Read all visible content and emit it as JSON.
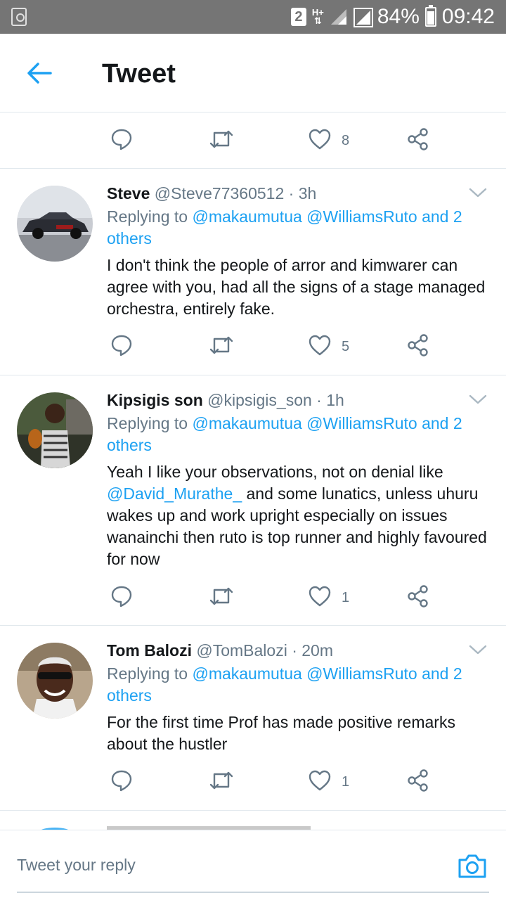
{
  "status_bar": {
    "sim": "2",
    "network": "H+",
    "battery": "84%",
    "time": "09:42"
  },
  "header": {
    "back_icon": "arrow-left-icon",
    "title": "Tweet"
  },
  "colors": {
    "accent": "#1da1f2",
    "secondary_text": "#657786",
    "primary_text": "#14171a",
    "divider": "#e1e8ed"
  },
  "top_actions": {
    "like_count": "8"
  },
  "tweets": [
    {
      "name": "Steve",
      "handle": "@Steve77360512",
      "time": "· 3h",
      "replying_prefix": "Replying to",
      "replying_to": "@makaumutua @WilliamsRuto and 2 others",
      "text": "I don't think the people of arror and kimwarer can agree with you, had all the signs of a stage managed orchestra, entirely fake.",
      "like_count": "5"
    },
    {
      "name": "Kipsigis son",
      "handle": "@kipsigis_son",
      "time": "· 1h",
      "replying_prefix": "Replying to",
      "replying_to": "@makaumutua @WilliamsRuto and 2 others",
      "text_before": "Yeah I like your observations, not on denial like",
      "text_mention": "@David_Murathe_",
      "text_after": "and some lunatics, unless uhuru wakes up and work upright especially on issues wanainchi then ruto is top runner and highly favoured for now",
      "like_count": "1"
    },
    {
      "name": "Tom Balozi",
      "handle": "@TomBalozi",
      "time": "· 20m",
      "replying_prefix": "Replying to",
      "replying_to": "@makaumutua @WilliamsRuto and 2 others",
      "text": "For the first time Prof has made positive remarks about the hustler",
      "like_count": "1"
    }
  ],
  "reply_bar": {
    "placeholder": "Tweet your reply",
    "camera_icon": "camera-icon"
  }
}
